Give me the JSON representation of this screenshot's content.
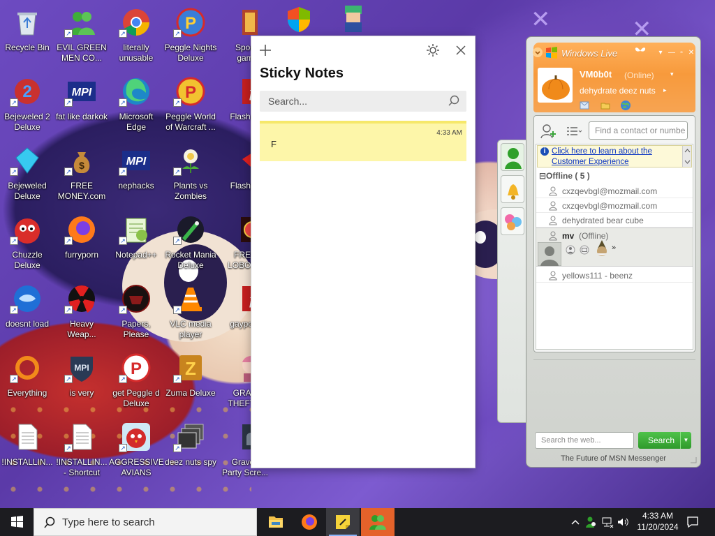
{
  "desktop": {
    "icons": [
      {
        "label": "Recycle Bin"
      },
      {
        "label": "EVIL GREEN\nMEN CO..."
      },
      {
        "label": "literally\nunusable"
      },
      {
        "label": "Peggle Nights\nDeluxe"
      },
      {
        "label": "Spoo\ngam"
      },
      {
        "label": "Bejeweled 2\nDeluxe"
      },
      {
        "label": "fat like darkok"
      },
      {
        "label": "Microsoft\nEdge"
      },
      {
        "label": "Peggle World\nof Warcraft ..."
      },
      {
        "label": "Flash Pl"
      },
      {
        "label": "Bejeweled\nDeluxe"
      },
      {
        "label": "FREE\nMONEY.com"
      },
      {
        "label": "nephacks"
      },
      {
        "label": "Plants vs\nZombies"
      },
      {
        "label": "Flashpo"
      },
      {
        "label": "Chuzzle\nDeluxe"
      },
      {
        "label": "furryporn"
      },
      {
        "label": "Notepad++"
      },
      {
        "label": "Rocket Mania\nDeluxe"
      },
      {
        "label": "FREE\nLOBOTO"
      },
      {
        "label": "doesnt load"
      },
      {
        "label": "Heavy\nWeap..."
      },
      {
        "label": "Papers, Please"
      },
      {
        "label": "VLC media\nplayer"
      },
      {
        "label": "gayporn"
      },
      {
        "label": "Everything"
      },
      {
        "label": "is very"
      },
      {
        "label": "get Peggle d\nDeluxe"
      },
      {
        "label": "Zuma Deluxe"
      },
      {
        "label": "GRAN\nTHEFT A"
      },
      {
        "label": "!INSTALLIN..."
      },
      {
        "label": "!INSTALLIN...\n- Shortcut"
      },
      {
        "label": "AGGRESSIVE\nAVIANS"
      },
      {
        "label": "deez nuts spy"
      },
      {
        "label": "Gravey\nParty Scre..."
      }
    ]
  },
  "sticky": {
    "title": "Sticky Notes",
    "search_placeholder": "Search...",
    "note": {
      "time": "4:33 AM",
      "text": "F"
    }
  },
  "messenger": {
    "brand": "Windows Live",
    "user": {
      "name": "VM0b0t",
      "status": "(Online)",
      "message": "dehydrate deez nuts"
    },
    "find_placeholder": "Find a contact or numbe",
    "promo": "Click here to learn about the Customer Experience",
    "group": "⊟Offline ( 5 )",
    "contacts": [
      {
        "name": "cxzqevbgl@mozmail.com"
      },
      {
        "name": "cxzqevbgl@mozmail.com"
      },
      {
        "name": "dehydrated bear cube"
      },
      {
        "name": "mv",
        "status": "(Offline)"
      },
      {
        "name": "yellows111 - beenz"
      }
    ],
    "web_search_placeholder": "Search the web...",
    "search_button": "Search",
    "footer": "The Future of MSN Messenger"
  },
  "taskbar": {
    "search_text": "Type here to search",
    "time": "4:33 AM",
    "date": "11/20/2024"
  }
}
